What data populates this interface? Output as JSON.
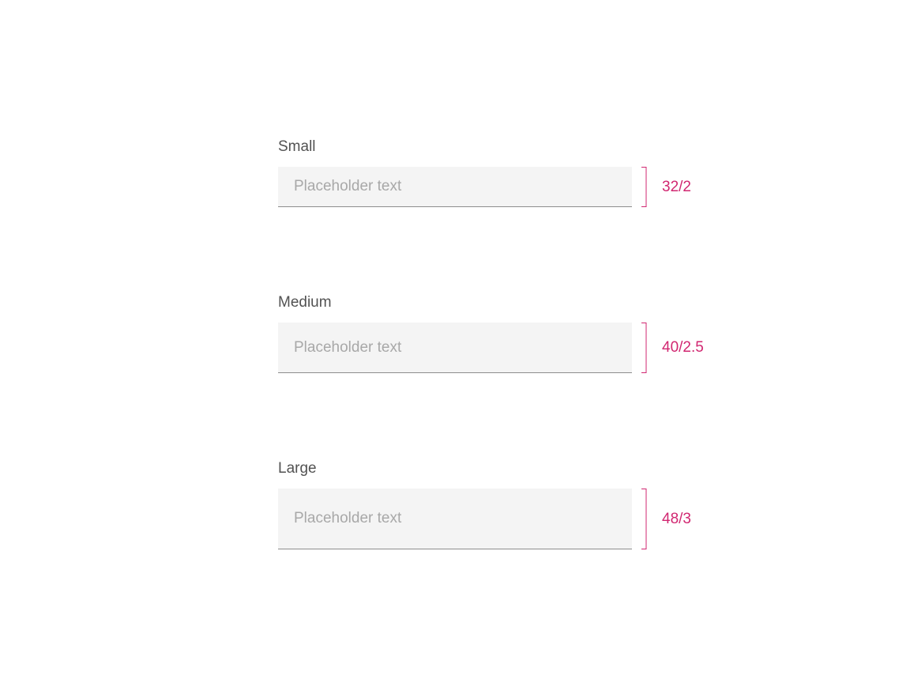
{
  "accent": "#d12771",
  "small": {
    "label": "Small",
    "placeholder": "Placeholder text",
    "note": "32/2"
  },
  "medium": {
    "label": "Medium",
    "placeholder": "Placeholder text",
    "note": "40/2.5"
  },
  "large": {
    "label": "Large",
    "placeholder": "Placeholder text",
    "note": "48/3"
  }
}
